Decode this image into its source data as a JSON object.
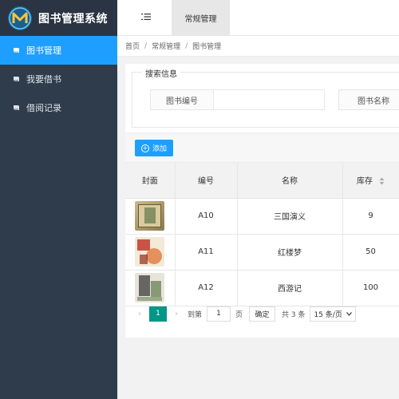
{
  "app": {
    "title": "图书管理系统"
  },
  "sidebar": {
    "items": [
      {
        "label": "图书管理",
        "icon": "book-icon",
        "active": true
      },
      {
        "label": "我要借书",
        "icon": "book-icon",
        "active": false
      },
      {
        "label": "借阅记录",
        "icon": "book-icon",
        "active": false
      }
    ]
  },
  "header": {
    "tab_label": "常规管理",
    "menu_icon": "menu-toggle-icon"
  },
  "breadcrumb": {
    "items": [
      "首页",
      "常规管理",
      "图书管理"
    ],
    "separator": "/"
  },
  "search": {
    "legend": "搜索信息",
    "fields": [
      {
        "label": "图书编号",
        "value": ""
      },
      {
        "label": "图书名称",
        "value": ""
      }
    ]
  },
  "toolbar": {
    "add_label": "添加",
    "add_icon": "plus-circle-icon"
  },
  "table": {
    "columns": [
      "封面",
      "编号",
      "名称",
      "库存"
    ],
    "rows": [
      {
        "code": "A10",
        "name": "三国演义",
        "stock": "9"
      },
      {
        "code": "A11",
        "name": "红楼梦",
        "stock": "50"
      },
      {
        "code": "A12",
        "name": "西游记",
        "stock": "100"
      }
    ]
  },
  "pager": {
    "current_page": "1",
    "goto_prefix": "到第",
    "goto_value": "1",
    "goto_suffix": "页",
    "confirm_label": "确定",
    "total_text": "共 3 条",
    "page_size": "15 条/页"
  },
  "colors": {
    "sidebar_bg": "#2e3c4c",
    "accent": "#1e9fff",
    "pager_active": "#009688"
  }
}
